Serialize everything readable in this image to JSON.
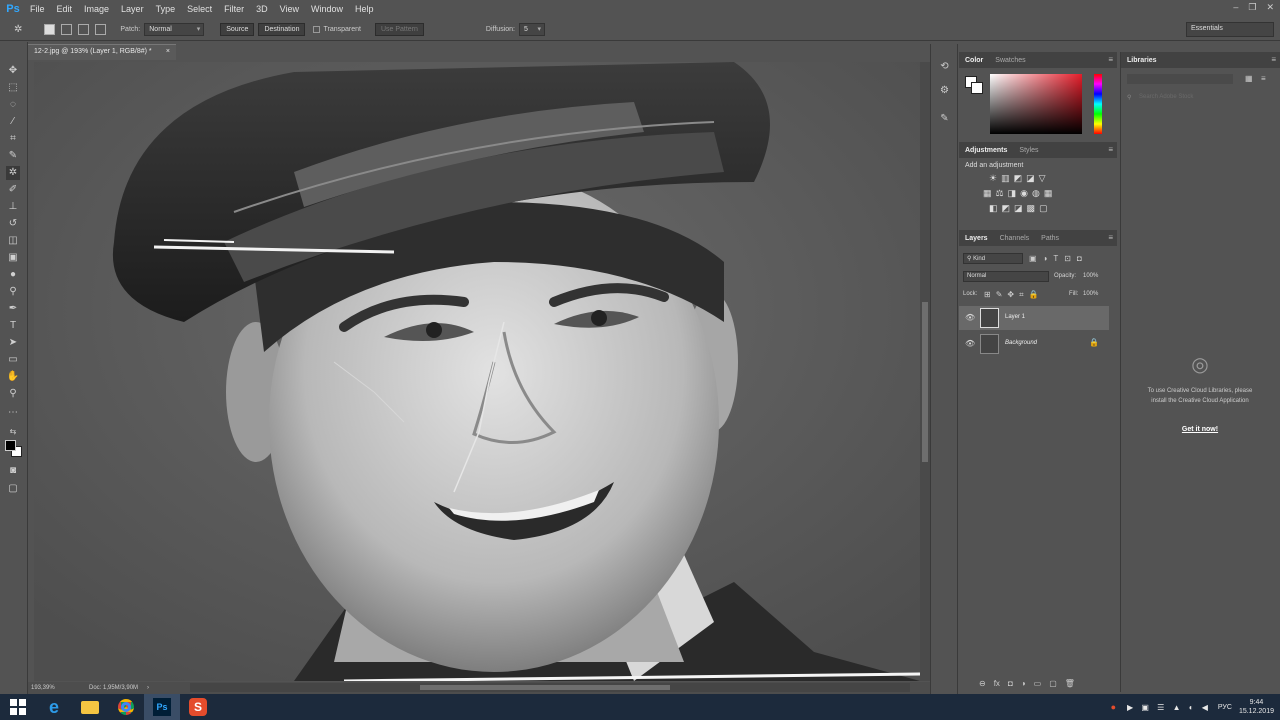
{
  "app": {
    "logo": "Ps",
    "menu": [
      "File",
      "Edit",
      "Image",
      "Layer",
      "Type",
      "Select",
      "Filter",
      "3D",
      "View",
      "Window",
      "Help"
    ],
    "window_controls": [
      "–",
      "❐",
      "✕"
    ]
  },
  "options_bar": {
    "patch_label": "Patch:",
    "patch_mode": "Normal",
    "source_label": "Source",
    "destination_label": "Destination",
    "transparent_label": "Transparent",
    "use_pattern_label": "Use Pattern",
    "diffusion_label": "Diffusion:",
    "diffusion_value": "5",
    "workspace": "Essentials"
  },
  "document": {
    "tab_title": "12-2.jpg @ 193% (Layer 1, RGB/8#) *",
    "close": "×",
    "zoom": "193,39%",
    "doc_info": "Doc: 1,95M/3,90M",
    "status_arrow": "›"
  },
  "color_panel": {
    "tabs": [
      "Color",
      "Swatches"
    ],
    "menu_icon": "≡"
  },
  "adjustments_panel": {
    "tabs": [
      "Adjustments",
      "Styles"
    ],
    "subtitle": "Add an adjustment",
    "row1": [
      "☀",
      "▥",
      "◩",
      "◪",
      "▽"
    ],
    "row2": [
      "▦",
      "⚖",
      "◨",
      "◉",
      "◍",
      "▦"
    ],
    "row3": [
      "◧",
      "◩",
      "◪",
      "▩",
      "▢"
    ]
  },
  "layers_panel": {
    "tabs": [
      "Layers",
      "Channels",
      "Paths"
    ],
    "kind_label": "Kind",
    "blend_mode": "Normal",
    "opacity_label": "Opacity:",
    "opacity_value": "100%",
    "lock_label": "Lock:",
    "fill_label": "Fill:",
    "fill_value": "100%",
    "layers": [
      {
        "name": "Layer 1",
        "selected": true,
        "locked": false
      },
      {
        "name": "Background",
        "selected": false,
        "locked": true
      }
    ],
    "footer_icons": [
      "⊖",
      "fx",
      "◘",
      "◑",
      "▭",
      "▢",
      "🗑"
    ]
  },
  "libraries_panel": {
    "title": "Libraries",
    "search_placeholder": "Search Adobe Stock",
    "message": "To use Creative Cloud Libraries, please install the Creative Cloud Application",
    "link": "Get it now!"
  },
  "taskbar": {
    "apps": [
      "windows-start",
      "internet-explorer",
      "file-explorer",
      "chrome",
      "photoshop",
      "screencast"
    ],
    "language": "РУС",
    "time": "9:44",
    "date": "15.12.2019"
  }
}
